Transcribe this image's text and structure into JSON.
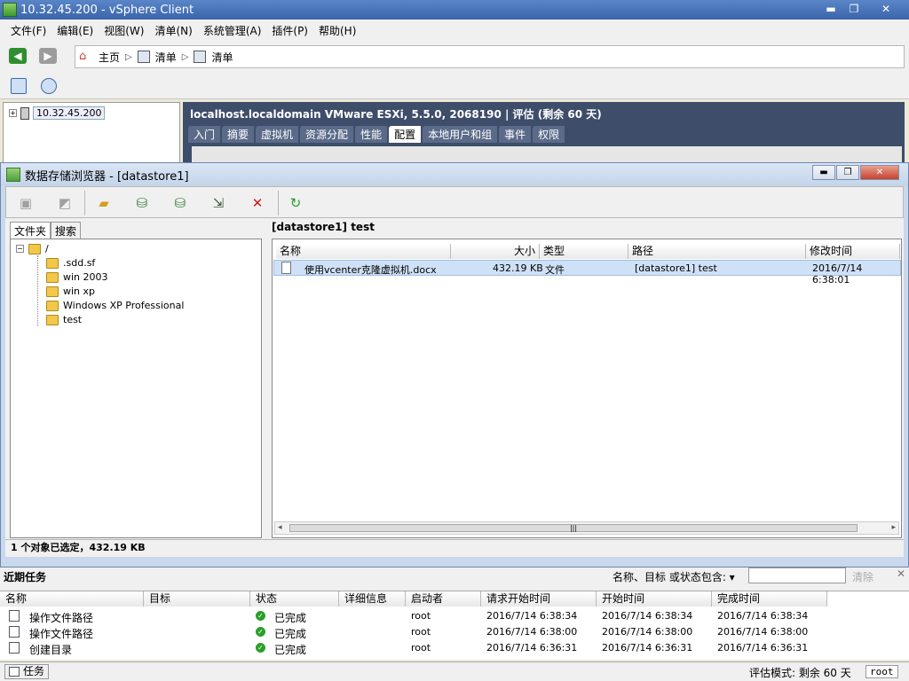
{
  "window": {
    "title": "10.32.45.200 - vSphere Client",
    "minimize": "▬",
    "maximize": "❐",
    "close": "✕"
  },
  "menu": [
    "文件(F)",
    "编辑(E)",
    "视图(W)",
    "清单(N)",
    "系统管理(A)",
    "插件(P)",
    "帮助(H)"
  ],
  "nav": {
    "back": "◀",
    "forward": "▶",
    "home": "主页",
    "crumb1": "清单",
    "crumb2": "清单"
  },
  "tree": {
    "host": "10.32.45.200"
  },
  "host": {
    "title": "localhost.localdomain VMware ESXi, 5.5.0, 2068190 | 评估 (剩余 60 天)",
    "tabs": [
      "入门",
      "摘要",
      "虚拟机",
      "资源分配",
      "性能",
      "配置",
      "本地用户和组",
      "事件",
      "权限"
    ],
    "active_tab": "配置"
  },
  "datastore": {
    "title": "数据存储浏览器 - [datastore1]",
    "tabs": [
      "文件夹",
      "搜索"
    ],
    "folders": [
      "/",
      ".sdd.sf",
      "win 2003",
      "win xp",
      "Windows XP Professional",
      "test"
    ],
    "current_path": "[datastore1] test",
    "columns": [
      "名称",
      "大小",
      "类型",
      "路径",
      "修改时间"
    ],
    "files": [
      {
        "name": "使用vcenter克隆虚拟机.docx",
        "size": "432.19 KB",
        "type": "文件",
        "path": "[datastore1] test",
        "modified": "2016/7/14 6:38:01"
      }
    ],
    "scroll_thumb": "|||",
    "status": "1 个对象已选定，432.19 KB"
  },
  "tasks": {
    "title": "近期任务",
    "filter_label": "名称、目标 或状态包含: ▾",
    "clear": "清除",
    "close": "✕",
    "columns": [
      "名称",
      "目标",
      "状态",
      "详细信息",
      "启动者",
      "请求开始时间",
      "开始时间",
      "完成时间"
    ],
    "rows": [
      {
        "name": "操作文件路径",
        "target": "",
        "status": "已完成",
        "details": "",
        "initiator": "root",
        "requested": "2016/7/14 6:38:34",
        "start": "2016/7/14 6:38:34",
        "end": "2016/7/14 6:38:34"
      },
      {
        "name": "操作文件路径",
        "target": "",
        "status": "已完成",
        "details": "",
        "initiator": "root",
        "requested": "2016/7/14 6:38:00",
        "start": "2016/7/14 6:38:00",
        "end": "2016/7/14 6:38:00"
      },
      {
        "name": "创建目录",
        "target": "",
        "status": "已完成",
        "details": "",
        "initiator": "root",
        "requested": "2016/7/14 6:36:31",
        "start": "2016/7/14 6:36:31",
        "end": "2016/7/14 6:36:31"
      }
    ]
  },
  "statusbar": {
    "tasks": "任务",
    "eval_mode": "评估模式: 剩余 60 天",
    "user": "root"
  }
}
